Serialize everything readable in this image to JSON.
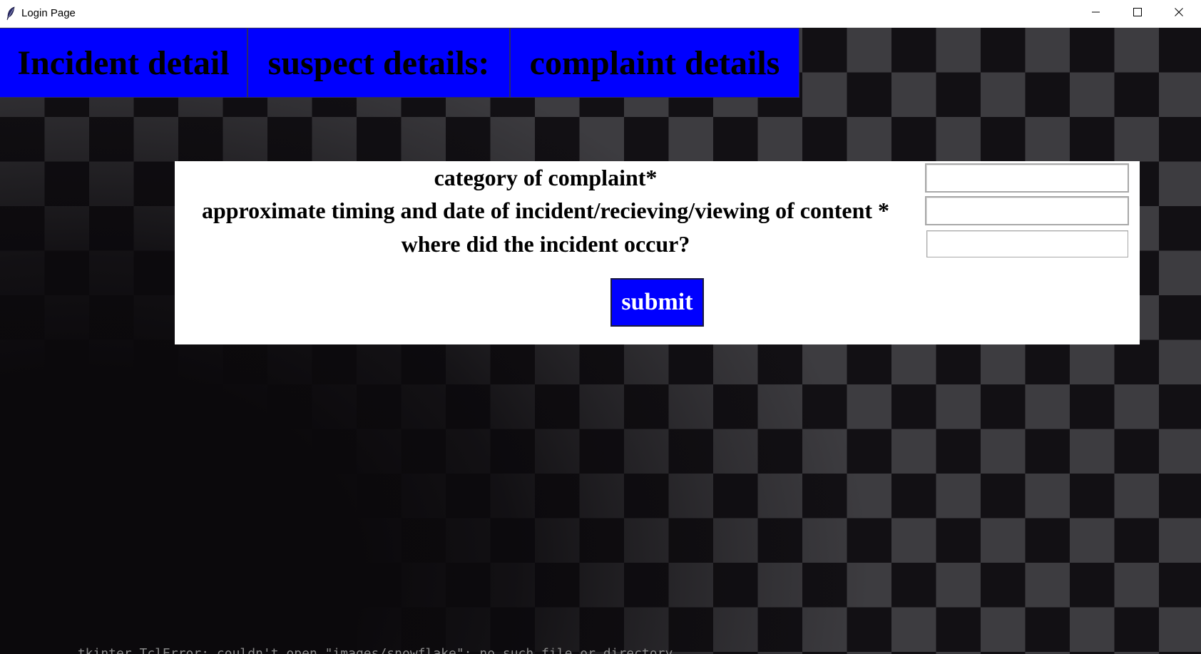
{
  "window": {
    "title": "Login Page",
    "minimize_icon": "minimize-icon",
    "maximize_icon": "maximize-icon",
    "close_icon": "close-icon",
    "app_icon": "feather-icon"
  },
  "tabs": [
    {
      "label": "Incident detail"
    },
    {
      "label": "suspect details:"
    },
    {
      "label": "complaint details"
    }
  ],
  "form": {
    "fields": [
      {
        "label": "category of complaint*",
        "value": ""
      },
      {
        "label": "approximate timing and date of incident/recieving/viewing of content *",
        "value": ""
      },
      {
        "label": "where did the incident occur?",
        "value": ""
      }
    ],
    "submit_label": "submit"
  },
  "footer": {
    "terminal_text": "_tkinter.TclError: couldn't open \"images/snowflake\": no such file or directory"
  },
  "colors": {
    "tab_background": "#0000ff",
    "button_background": "#0000ff",
    "panel_background": "#ffffff",
    "backdrop_dark": "#0b090c",
    "checker_light": "#3d3c40"
  }
}
